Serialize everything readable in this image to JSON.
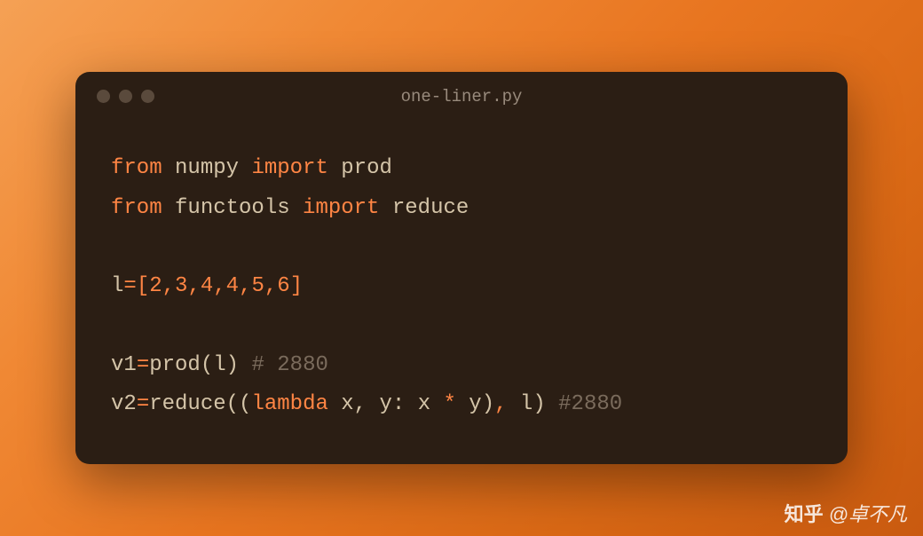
{
  "window": {
    "title": "one-liner.py"
  },
  "code": {
    "line1": {
      "from": "from",
      "module1": "numpy",
      "import": "import",
      "name1": "prod"
    },
    "line2": {
      "from": "from",
      "module2": "functools",
      "import": "import",
      "name2": "reduce"
    },
    "line4": {
      "var": "l",
      "eq": "=",
      "lbracket": "[",
      "n1": "2",
      "c1": ",",
      "n2": "3",
      "c2": ",",
      "n3": "4",
      "c3": ",",
      "n4": "4",
      "c4": ",",
      "n5": "5",
      "c5": ",",
      "n6": "6",
      "rbracket": "]"
    },
    "line6": {
      "var": "v1",
      "eq": "=",
      "fn": "prod",
      "lp": "(",
      "arg": "l",
      "rp": ")",
      "comment": "# 2880"
    },
    "line7": {
      "var": "v2",
      "eq": "=",
      "fn": "reduce",
      "lp1": "(",
      "lp2": "(",
      "lambda": "lambda",
      "params": " x, y: x ",
      "star": "*",
      "y": " y",
      "rp1": ")",
      "comma": ",",
      "arg": " l",
      "rp2": ")",
      "comment": "#2880"
    }
  },
  "watermark": {
    "logo": "知乎",
    "text": "@卓不凡"
  }
}
